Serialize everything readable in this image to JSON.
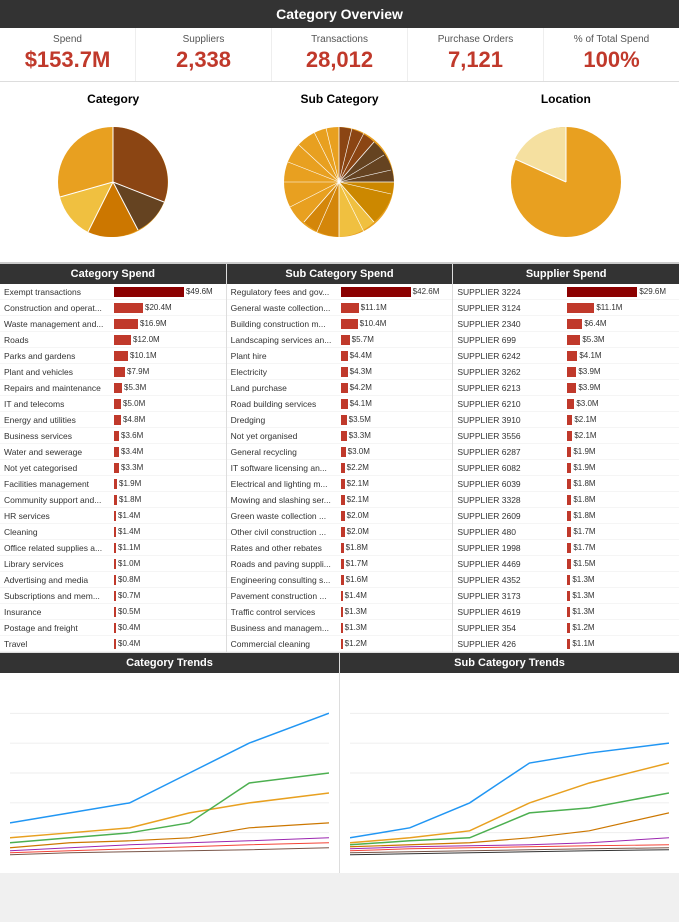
{
  "header": {
    "title": "Category Overview"
  },
  "summary": {
    "spend_label": "Spend",
    "spend_value": "$153.7M",
    "suppliers_label": "Suppliers",
    "suppliers_value": "2,338",
    "transactions_label": "Transactions",
    "transactions_value": "28,012",
    "purchase_orders_label": "Purchase Orders",
    "purchase_orders_value": "7,121",
    "pct_label": "% of Total Spend",
    "pct_value": "100%"
  },
  "pie_charts": {
    "category_title": "Category",
    "subcategory_title": "Sub Category",
    "location_title": "Location"
  },
  "category_spend": {
    "title": "Category Spend",
    "rows": [
      {
        "label": "Exempt transactions",
        "amount": "$49.6M",
        "pct": 100
      },
      {
        "label": "Construction and operat...",
        "amount": "$20.4M",
        "pct": 41
      },
      {
        "label": "Waste management and...",
        "amount": "$16.9M",
        "pct": 34
      },
      {
        "label": "Roads",
        "amount": "$12.0M",
        "pct": 24
      },
      {
        "label": "Parks and gardens",
        "amount": "$10.1M",
        "pct": 20
      },
      {
        "label": "Plant and vehicles",
        "amount": "$7.9M",
        "pct": 16
      },
      {
        "label": "Repairs and maintenance",
        "amount": "$5.3M",
        "pct": 11
      },
      {
        "label": "IT and telecoms",
        "amount": "$5.0M",
        "pct": 10
      },
      {
        "label": "Energy and utilities",
        "amount": "$4.8M",
        "pct": 10
      },
      {
        "label": "Business services",
        "amount": "$3.6M",
        "pct": 7
      },
      {
        "label": "Water and sewerage",
        "amount": "$3.4M",
        "pct": 7
      },
      {
        "label": "Not yet categorised",
        "amount": "$3.3M",
        "pct": 7
      },
      {
        "label": "Facilities management",
        "amount": "$1.9M",
        "pct": 4
      },
      {
        "label": "Community support and...",
        "amount": "$1.8M",
        "pct": 4
      },
      {
        "label": "HR services",
        "amount": "$1.4M",
        "pct": 3
      },
      {
        "label": "Cleaning",
        "amount": "$1.4M",
        "pct": 3
      },
      {
        "label": "Office related supplies a...",
        "amount": "$1.1M",
        "pct": 2
      },
      {
        "label": "Library services",
        "amount": "$1.0M",
        "pct": 2
      },
      {
        "label": "Advertising and media",
        "amount": "$0.8M",
        "pct": 2
      },
      {
        "label": "Subscriptions and mem...",
        "amount": "$0.7M",
        "pct": 1
      },
      {
        "label": "Insurance",
        "amount": "$0.5M",
        "pct": 1
      },
      {
        "label": "Postage and freight",
        "amount": "$0.4M",
        "pct": 1
      },
      {
        "label": "Travel",
        "amount": "$0.4M",
        "pct": 1
      }
    ]
  },
  "subcategory_spend": {
    "title": "Sub Category Spend",
    "rows": [
      {
        "label": "Regulatory fees and gov...",
        "amount": "$42.6M",
        "pct": 100
      },
      {
        "label": "General waste collection...",
        "amount": "$11.1M",
        "pct": 26
      },
      {
        "label": "Building construction m...",
        "amount": "$10.4M",
        "pct": 24
      },
      {
        "label": "Landscaping services an...",
        "amount": "$5.7M",
        "pct": 13
      },
      {
        "label": "Plant hire",
        "amount": "$4.4M",
        "pct": 10
      },
      {
        "label": "Electricity",
        "amount": "$4.3M",
        "pct": 10
      },
      {
        "label": "Land purchase",
        "amount": "$4.2M",
        "pct": 10
      },
      {
        "label": "Road building services",
        "amount": "$4.1M",
        "pct": 10
      },
      {
        "label": "Dredging",
        "amount": "$3.5M",
        "pct": 8
      },
      {
        "label": "Not yet organised",
        "amount": "$3.3M",
        "pct": 8
      },
      {
        "label": "General recycling",
        "amount": "$3.0M",
        "pct": 7
      },
      {
        "label": "IT software licensing an...",
        "amount": "$2.2M",
        "pct": 5
      },
      {
        "label": "Electrical and lighting m...",
        "amount": "$2.1M",
        "pct": 5
      },
      {
        "label": "Mowing and slashing ser...",
        "amount": "$2.1M",
        "pct": 5
      },
      {
        "label": "Green waste collection ...",
        "amount": "$2.0M",
        "pct": 5
      },
      {
        "label": "Other civil construction ...",
        "amount": "$2.0M",
        "pct": 5
      },
      {
        "label": "Rates and other rebates",
        "amount": "$1.8M",
        "pct": 4
      },
      {
        "label": "Roads and paving suppli...",
        "amount": "$1.7M",
        "pct": 4
      },
      {
        "label": "Engineering consulting s...",
        "amount": "$1.6M",
        "pct": 4
      },
      {
        "label": "Pavement construction ...",
        "amount": "$1.4M",
        "pct": 3
      },
      {
        "label": "Traffic control services",
        "amount": "$1.3M",
        "pct": 3
      },
      {
        "label": "Business and managem...",
        "amount": "$1.3M",
        "pct": 3
      },
      {
        "label": "Commercial cleaning",
        "amount": "$1.2M",
        "pct": 3
      }
    ]
  },
  "supplier_spend": {
    "title": "Supplier Spend",
    "rows": [
      {
        "label": "SUPPLIER 3224",
        "amount": "$29.6M",
        "pct": 100
      },
      {
        "label": "SUPPLIER 3124",
        "amount": "$11.1M",
        "pct": 38
      },
      {
        "label": "SUPPLIER 2340",
        "amount": "$6.4M",
        "pct": 22
      },
      {
        "label": "SUPPLIER 699",
        "amount": "$5.3M",
        "pct": 18
      },
      {
        "label": "SUPPLIER 6242",
        "amount": "$4.1M",
        "pct": 14
      },
      {
        "label": "SUPPLIER 3262",
        "amount": "$3.9M",
        "pct": 13
      },
      {
        "label": "SUPPLIER 6213",
        "amount": "$3.9M",
        "pct": 13
      },
      {
        "label": "SUPPLIER 6210",
        "amount": "$3.0M",
        "pct": 10
      },
      {
        "label": "SUPPLIER 3910",
        "amount": "$2.1M",
        "pct": 7
      },
      {
        "label": "SUPPLIER 3556",
        "amount": "$2.1M",
        "pct": 7
      },
      {
        "label": "SUPPLIER 6287",
        "amount": "$1.9M",
        "pct": 6
      },
      {
        "label": "SUPPLIER 6082",
        "amount": "$1.9M",
        "pct": 6
      },
      {
        "label": "SUPPLIER 6039",
        "amount": "$1.8M",
        "pct": 6
      },
      {
        "label": "SUPPLIER 3328",
        "amount": "$1.8M",
        "pct": 6
      },
      {
        "label": "SUPPLIER 2609",
        "amount": "$1.8M",
        "pct": 6
      },
      {
        "label": "SUPPLIER 480",
        "amount": "$1.7M",
        "pct": 6
      },
      {
        "label": "SUPPLIER 1998",
        "amount": "$1.7M",
        "pct": 6
      },
      {
        "label": "SUPPLIER 4469",
        "amount": "$1.5M",
        "pct": 5
      },
      {
        "label": "SUPPLIER 4352",
        "amount": "$1.3M",
        "pct": 4
      },
      {
        "label": "SUPPLIER 3173",
        "amount": "$1.3M",
        "pct": 4
      },
      {
        "label": "SUPPLIER 4619",
        "amount": "$1.3M",
        "pct": 4
      },
      {
        "label": "SUPPLIER 354",
        "amount": "$1.2M",
        "pct": 4
      },
      {
        "label": "SUPPLIER 426",
        "amount": "$1.1M",
        "pct": 4
      }
    ]
  },
  "trends": {
    "category_title": "Category Trends",
    "subcategory_title": "Sub Category Trends"
  }
}
